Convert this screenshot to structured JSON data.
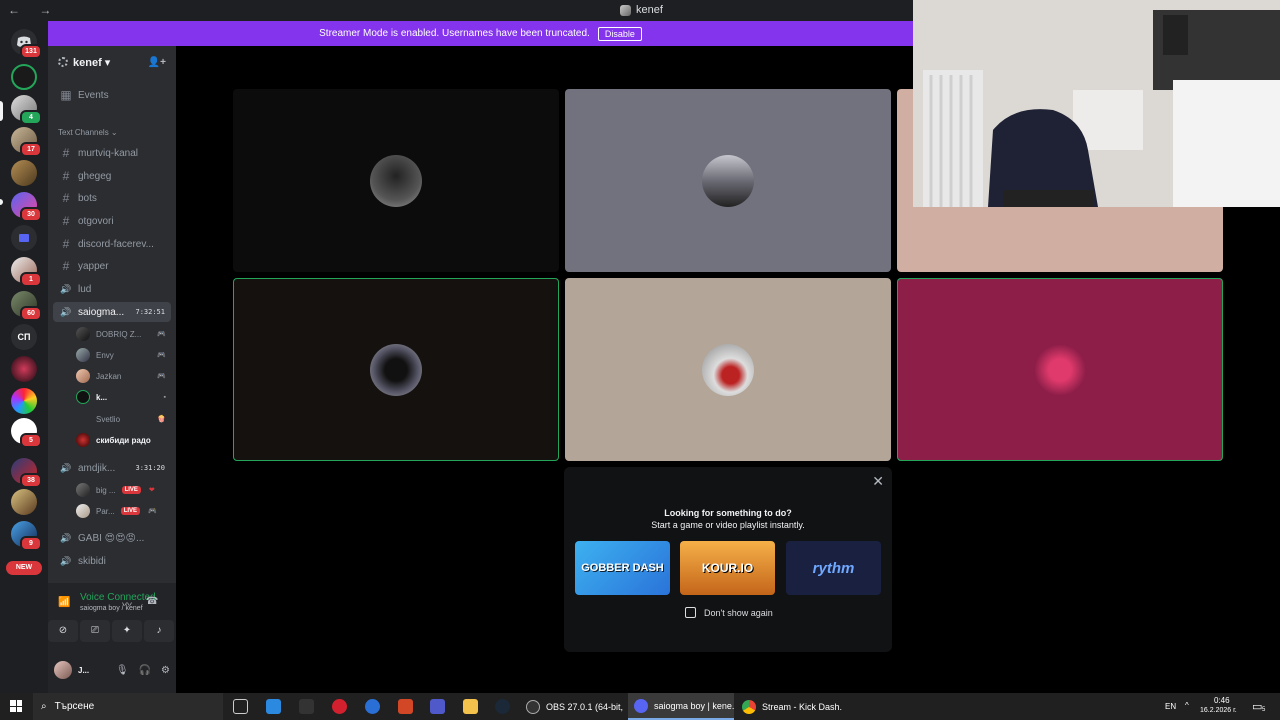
{
  "titlebar": {
    "title": "kenef",
    "nav": "← →"
  },
  "banner": {
    "text": "Streamer Mode is enabled. Usernames have been truncated.",
    "button": "Disable",
    "color": "#8434ec"
  },
  "rail": {
    "badges": [
      "131",
      "4",
      "17",
      "30",
      "1",
      "60",
      "5",
      "38",
      "9"
    ],
    "server_text": "СП",
    "new_label": "NEW"
  },
  "guild": {
    "name": "kenef ▾",
    "events": "Events",
    "section": "Text Channels ⌄"
  },
  "channels": [
    {
      "name": "murtviq-kanal",
      "icon": "#"
    },
    {
      "name": "ghegeg",
      "icon": "#"
    },
    {
      "name": "bots",
      "icon": "#"
    },
    {
      "name": "otgovori",
      "icon": "#"
    },
    {
      "name": "discord-facerev...",
      "icon": "#"
    },
    {
      "name": "yapper",
      "icon": "#"
    },
    {
      "name": "lud",
      "icon": "🔊"
    }
  ],
  "voice_channels": [
    {
      "name": "saiogma...",
      "timer": "7:32:51",
      "users": [
        {
          "name": "DOBRIQ Z...",
          "status": "🎮"
        },
        {
          "name": "Envy",
          "status": "🎮"
        },
        {
          "name": "Jazkan",
          "status": "🎮"
        },
        {
          "name": "k...",
          "status": "▪"
        },
        {
          "name": "Svetlio",
          "status": "🍿"
        },
        {
          "name": "скибиди радо",
          "status": ""
        }
      ]
    },
    {
      "name": "amdjik...",
      "timer": "3:31:20",
      "users": [
        {
          "name": "big ...",
          "live": "LIVE",
          "status": "❤"
        },
        {
          "name": "Par...",
          "live": "LIVE",
          "status": "🎮"
        }
      ]
    },
    {
      "name": "GABI 😍😍😡...",
      "timer": ""
    },
    {
      "name": "skibidi",
      "timer": ""
    }
  ],
  "voice_panel": {
    "status": "Voice Connected",
    "sub": "saiogma boy / kenef",
    "user": "J..."
  },
  "popup": {
    "line1": "Looking for something to do?",
    "line2": "Start a game or video playlist instantly.",
    "activities": [
      "GOBBER DASH",
      "KOUR.IO",
      "rythm"
    ],
    "checkbox": "Don't show again"
  },
  "taskbar": {
    "search": "Търсене",
    "apps": [
      "OBS 27.0.1 (64-bit, ...",
      "saiogma boy | kene...",
      "Stream - Kick Dash..."
    ],
    "lang": "EN",
    "time": "0:46",
    "date": "16.2.2026 г.",
    "notif": "5"
  },
  "colors": {
    "accent": "#8434ec",
    "green": "#23a55a",
    "red": "#da373c"
  }
}
